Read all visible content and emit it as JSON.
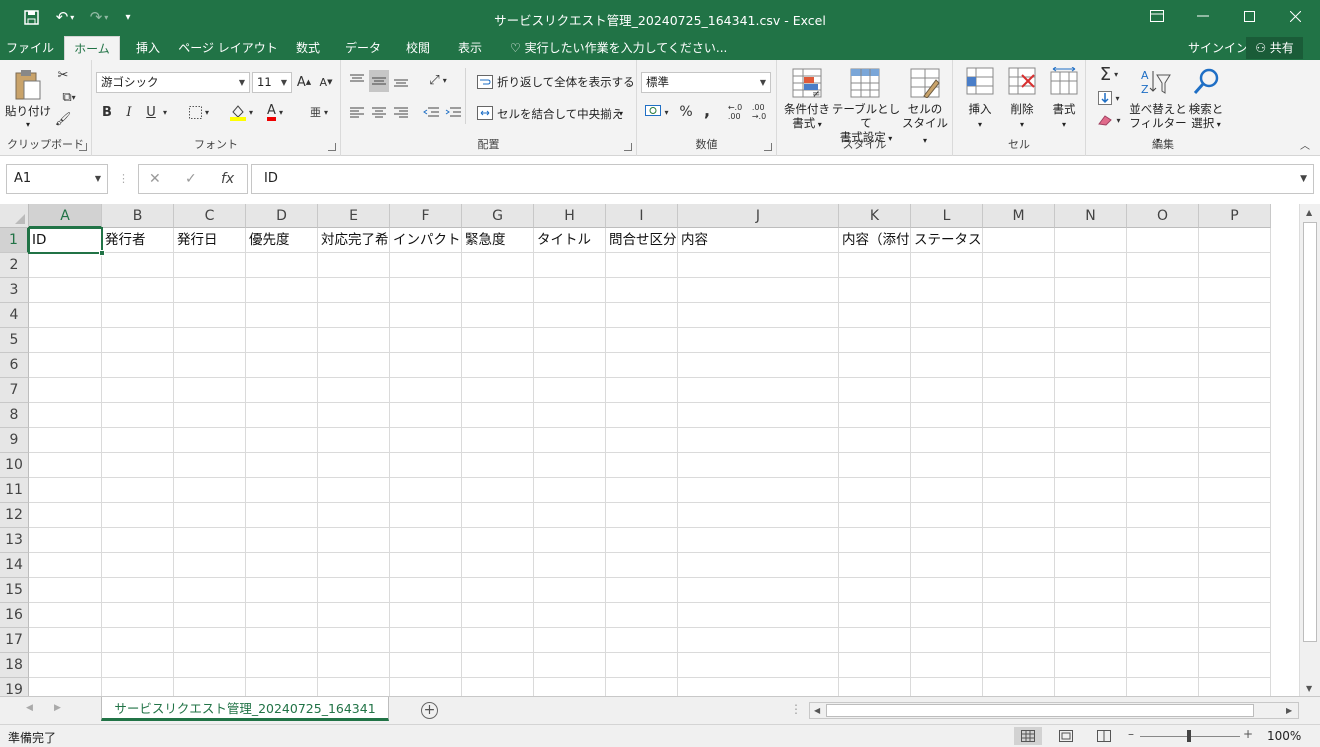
{
  "window": {
    "title": "サービスリクエスト管理_20240725_164341.csv - Excel",
    "minimize_icon": "minimize-icon",
    "maximize_icon": "maximize-icon",
    "close_icon": "close-icon"
  },
  "tabs": [
    "ファイル",
    "ホーム",
    "挿入",
    "ページ レイアウト",
    "数式",
    "データ",
    "校閲",
    "表示"
  ],
  "active_tab": "ホーム",
  "tell_me": "実行したい作業を入力してください...",
  "signin": "サインイン",
  "share": "共有",
  "ribbon": {
    "clipboard": {
      "label": "クリップボード",
      "paste": "貼り付け"
    },
    "font": {
      "label": "フォント",
      "font_name": "游ゴシック",
      "font_size": "11",
      "bold": "B",
      "italic": "I",
      "underline": "U"
    },
    "alignment": {
      "label": "配置",
      "wrap": "折り返して全体を表示する",
      "merge": "セルを結合して中央揃え"
    },
    "number": {
      "label": "数値",
      "format": "標準",
      "percent": "%",
      "comma": ","
    },
    "styles": {
      "label": "スタイル",
      "conditional": [
        "条件付き",
        "書式"
      ],
      "table": [
        "テーブルとして",
        "書式設定"
      ],
      "cell": [
        "セルの",
        "スタイル"
      ]
    },
    "cells": {
      "label": "セル",
      "insert": "挿入",
      "delete": "削除",
      "format": "書式"
    },
    "editing": {
      "label": "編集",
      "sort": [
        "並べ替えと",
        "フィルター"
      ],
      "find": [
        "検索と",
        "選択"
      ]
    }
  },
  "formula_bar": {
    "name_box": "A1",
    "fx": "fx",
    "content": "ID"
  },
  "grid": {
    "columns": [
      "A",
      "B",
      "C",
      "D",
      "E",
      "F",
      "G",
      "H",
      "I",
      "J",
      "K",
      "L",
      "M",
      "N",
      "O",
      "P"
    ],
    "rows": [
      "1",
      "2",
      "3",
      "4",
      "5",
      "6",
      "7",
      "8",
      "9",
      "10",
      "11",
      "12",
      "13",
      "14",
      "15",
      "16",
      "17",
      "18",
      "19"
    ],
    "row1": [
      "ID",
      "発行者",
      "発行日",
      "優先度",
      "対応完了希",
      "インパクト",
      "緊急度",
      "タイトル",
      "問合せ区分",
      "内容",
      "内容（添付",
      "ステータス"
    ]
  },
  "sheet_tab": "サービスリクエスト管理_20240725_164341",
  "status": {
    "text": "準備完了",
    "zoom": "100%"
  }
}
